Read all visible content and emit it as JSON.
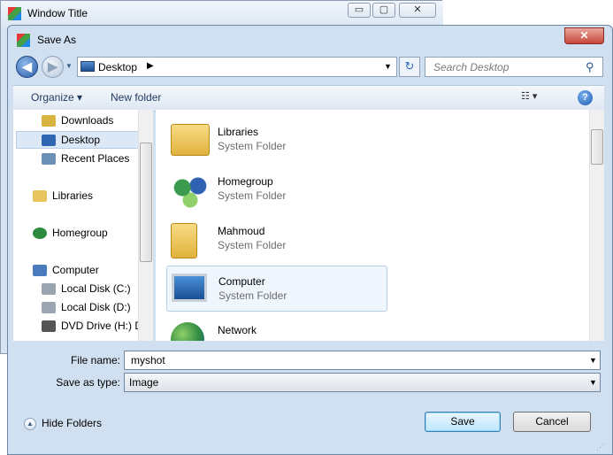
{
  "background_window": {
    "title": "Window Title",
    "controls": {
      "minimize": "▭",
      "maximize": "▢",
      "close": "✕"
    }
  },
  "dialog": {
    "title": "Save As",
    "close_glyph": "✕"
  },
  "nav": {
    "back_glyph": "◀",
    "forward_glyph": "▶",
    "address": {
      "location": "Desktop",
      "separator": "▶",
      "dropdown": "▼"
    },
    "refresh_glyph": "↻",
    "search": {
      "placeholder": "Search Desktop"
    }
  },
  "toolbar": {
    "organize": "Organize ▾",
    "new_folder": "New folder",
    "views": "☷ ▾",
    "help": "?"
  },
  "sidebar": {
    "items": [
      {
        "label": "Downloads",
        "icon": "downloads-folder-icon",
        "color": "#d9b340"
      },
      {
        "label": "Desktop",
        "icon": "desktop-icon",
        "color": "#2f66b3",
        "selected": true
      },
      {
        "label": "Recent Places",
        "icon": "recent-places-icon",
        "color": "#6c8fb7"
      },
      {
        "label": "Libraries",
        "icon": "libraries-icon",
        "color": "#e8c45c"
      },
      {
        "label": "Homegroup",
        "icon": "homegroup-icon",
        "color": "#2e8a3e"
      },
      {
        "label": "Computer",
        "icon": "computer-icon",
        "color": "#4b7bbd"
      },
      {
        "label": "Local Disk (C:)",
        "icon": "hard-disk-c-icon",
        "color": "#9aa5b1"
      },
      {
        "label": "Local Disk (D:)",
        "icon": "hard-disk-d-icon",
        "color": "#9aa5b1"
      },
      {
        "label": "DVD Drive (H:) D",
        "icon": "dvd-drive-icon",
        "color": "#555555"
      }
    ]
  },
  "files": [
    {
      "name": "Libraries",
      "type": "System Folder",
      "icon": "libraries-folder-icon"
    },
    {
      "name": "Homegroup",
      "type": "System Folder",
      "icon": "homegroup-icon"
    },
    {
      "name": "Mahmoud",
      "type": "System Folder",
      "icon": "user-folder-icon"
    },
    {
      "name": "Computer",
      "type": "System Folder",
      "icon": "computer-icon",
      "selected": true
    },
    {
      "name": "Network",
      "type": "",
      "icon": "network-icon"
    }
  ],
  "form": {
    "file_name_label": "File name:",
    "file_name_value": "myshot",
    "save_type_label": "Save as type:",
    "save_type_value": "Image",
    "dropdown_glyph": "▼"
  },
  "footer": {
    "hide_folders": "Hide Folders",
    "hide_glyph": "▲",
    "save": "Save",
    "cancel": "Cancel"
  },
  "colors": {
    "dialog_frame": "#d1e0f1",
    "selection": "#dce8f6",
    "close_red": "#c8453a"
  }
}
